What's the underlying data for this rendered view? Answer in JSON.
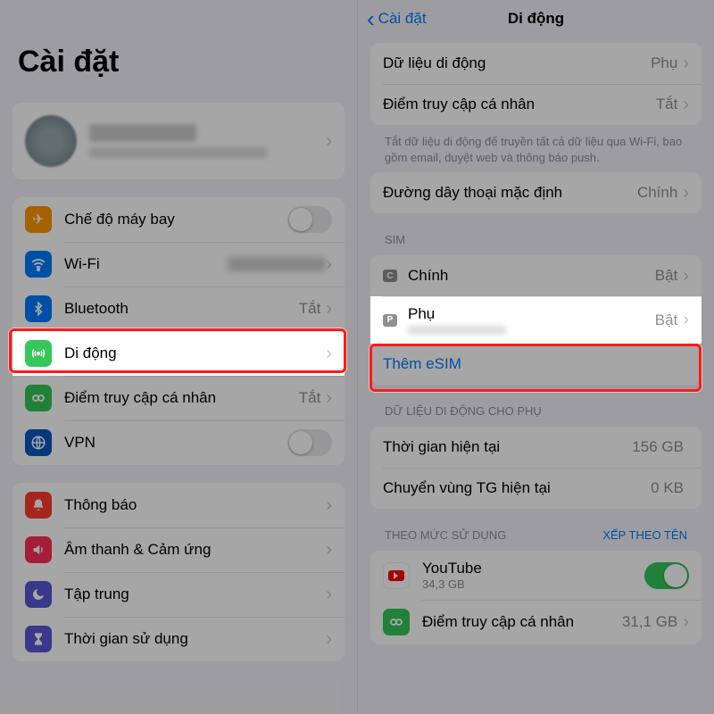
{
  "left": {
    "title": "Cài đặt",
    "rows": {
      "airplane": "Chế độ máy bay",
      "wifi": "Wi-Fi",
      "bluetooth": "Bluetooth",
      "bluetooth_val": "Tắt",
      "cellular": "Di động",
      "hotspot": "Điểm truy cập cá nhân",
      "hotspot_val": "Tắt",
      "vpn": "VPN",
      "notif": "Thông báo",
      "sound": "Âm thanh & Cảm ứng",
      "focus": "Tập trung",
      "screentime": "Thời gian sử dụng"
    }
  },
  "right": {
    "back": "Cài đặt",
    "title": "Di động",
    "cellular_data": "Dữ liệu di động",
    "cellular_data_val": "Phụ",
    "hotspot": "Điểm truy cập cá nhân",
    "hotspot_val": "Tắt",
    "footer1": "Tắt dữ liệu di động để truyền tất cả dữ liệu qua Wi-Fi, bao gồm email, duyệt web và thông báo push.",
    "voice_line": "Đường dây thoại mặc định",
    "voice_line_val": "Chính",
    "sim_head": "SIM",
    "sim_primary": "Chính",
    "sim_primary_val": "Bật",
    "sim_secondary": "Phụ",
    "sim_secondary_val": "Bật",
    "add_esim": "Thêm eSIM",
    "usage_head": "DỮ LIỆU DI ĐỘNG CHO PHỤ",
    "current": "Thời gian hiện tại",
    "current_val": "156 GB",
    "roam": "Chuyển vùng TG hiện tại",
    "roam_val": "0 KB",
    "by_usage": "THEO MỨC SỬ DỤNG",
    "by_name": "XẾP THEO TÊN",
    "yt": "YouTube",
    "yt_sub": "34,3 GB",
    "hs2": "Điểm truy cập cá nhân",
    "hs2_val": "31,1 GB"
  }
}
